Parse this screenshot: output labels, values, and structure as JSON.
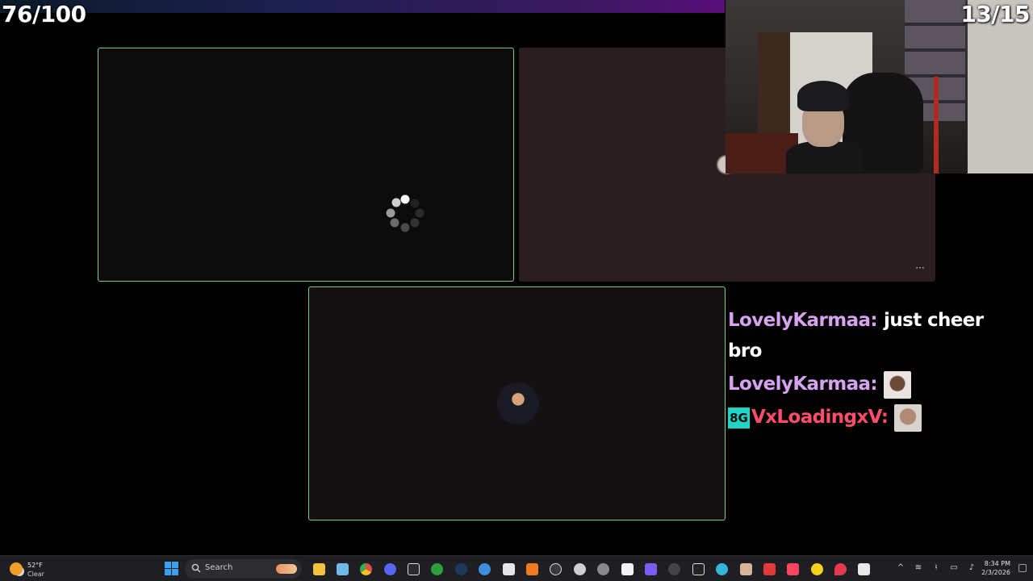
{
  "overlay": {
    "left_counter": "76/100",
    "right_counter": "13/15"
  },
  "tiles": {
    "more_button_label": "···"
  },
  "chat": [
    {
      "username": "LovelyKarmaa:",
      "username_color": "#d7a3f0",
      "message": "just cheer bro",
      "emote": null,
      "badge": null
    },
    {
      "username": "LovelyKarmaa:",
      "username_color": "#d7a3f0",
      "message": "",
      "emote": "laughing-face-emote",
      "badge": null
    },
    {
      "username": "VxLoadingxV:",
      "username_color": "#ff4d6a",
      "message": "",
      "emote": "face-palm-emote",
      "badge": "8G"
    }
  ],
  "taskbar": {
    "weather_temp": "52°F",
    "weather_condition": "Clear",
    "search_placeholder": "Search",
    "apps": [
      "file-explorer-icon",
      "calendar-icon",
      "chrome-icon",
      "discord-icon",
      "epic-games-icon",
      "xbox-icon",
      "steam-icon",
      "edge-icon",
      "minecraft-icon",
      "autodesk-icon",
      "obs-icon",
      "steelseries-icon",
      "game-launcher-icon",
      "roblox-icon",
      "grid-app-icon",
      "ok-app-icon",
      "capcut-icon",
      "edge-browser-icon",
      "photo-app-icon",
      "red-app-icon",
      "music-icon",
      "emoji-app-icon",
      "location-app-icon",
      "calculator-icon"
    ],
    "clock_time": "8:34 PM",
    "clock_date": "2/3/2026"
  },
  "colors": {
    "tile_border": "#77d08a",
    "accent_blue": "#3aa0f0"
  }
}
